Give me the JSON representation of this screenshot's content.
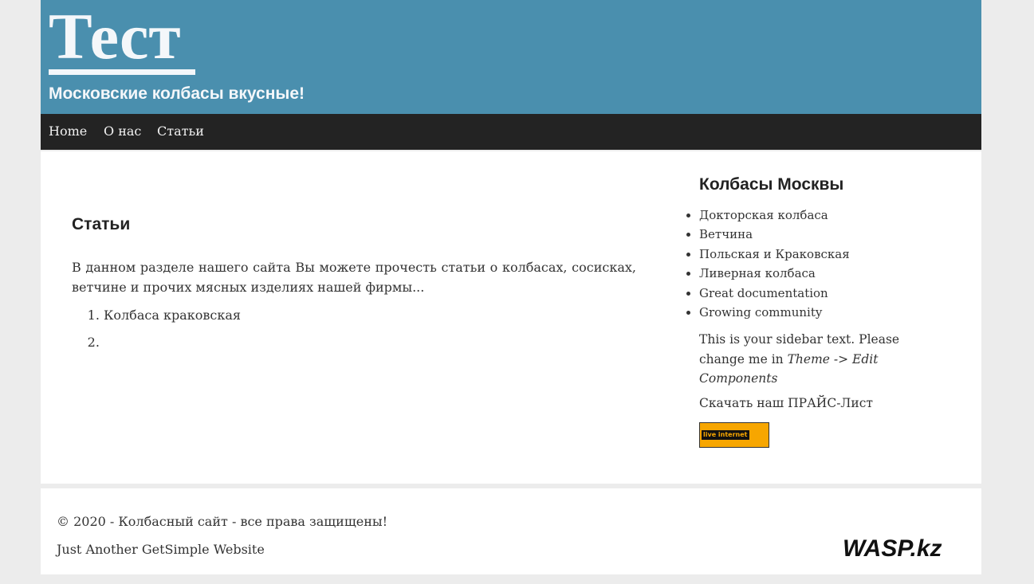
{
  "header": {
    "site_title": "Тест",
    "tagline": "Московские колбасы вкусные!"
  },
  "nav": {
    "items": [
      {
        "label": "Home"
      },
      {
        "label": "О нас"
      },
      {
        "label": "Статьи"
      }
    ]
  },
  "content": {
    "title": "Статьи",
    "text": "В данном разделе нашего сайта Вы можете прочесть статьи о колбасах, сосисках, ветчине и прочих мясных изделиях нашей фирмы...",
    "list": [
      "Колбаса краковская",
      ""
    ]
  },
  "sidebar": {
    "title": "Колбасы Москвы",
    "items": [
      "Докторская колбаса",
      "Ветчина",
      "Польская и Краковская",
      "Ливерная колбаса",
      "Great documentation",
      "Growing community"
    ],
    "text_prefix": "This is your sidebar text. Please change me in ",
    "text_em": "Theme -> Edit Components",
    "price_link": "Скачать наш ПРАЙС-Лист",
    "counter_label": "live internet"
  },
  "footer": {
    "copyright": "© 2020 - Колбасный сайт - все права защищены!",
    "powered": "Just Another GetSimple Website",
    "watermark": "WASP.kz"
  }
}
